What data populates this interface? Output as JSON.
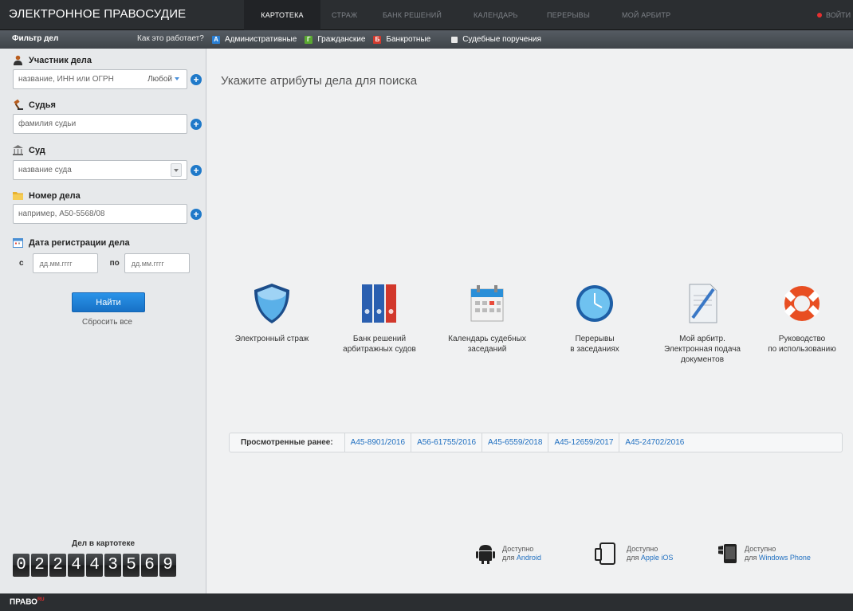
{
  "brand": "ЭЛЕКТРОННОЕ ПРАВОСУДИЕ",
  "nav": [
    "КАРТОТЕКА",
    "СТРАЖ",
    "БАНК РЕШЕНИЙ",
    "КАЛЕНДАРЬ",
    "ПЕРЕРЫВЫ",
    "МОЙ АРБИТР"
  ],
  "login": "ВОЙТИ",
  "filter": {
    "title": "Фильтр дел",
    "how": "Как это работает?",
    "categories": [
      {
        "badge": "А",
        "label": "Административные",
        "color": "#2a7fd4"
      },
      {
        "badge": "Г",
        "label": "Гражданские",
        "color": "#5aa832"
      },
      {
        "badge": "Б",
        "label": "Банкротные",
        "color": "#d23a2e"
      },
      {
        "badge": "",
        "label": "Судебные поручения",
        "color": "#e8e8e8"
      }
    ]
  },
  "sidebar": {
    "participant": {
      "label": "Участник дела",
      "placeholder": "название, ИНН или ОГРН",
      "any": "Любой"
    },
    "judge": {
      "label": "Судья",
      "placeholder": "фамилия судьи"
    },
    "court": {
      "label": "Суд",
      "placeholder": "название суда"
    },
    "case": {
      "label": "Номер дела",
      "placeholder": "например, А50-5568/08"
    },
    "date": {
      "label": "Дата регистрации дела",
      "from": "с",
      "to": "по",
      "placeholder": "дд.мм.гггг"
    },
    "find": "Найти",
    "reset": "Сбросить все",
    "counter_label": "Дел в картотеке",
    "counter": [
      "0",
      "2",
      "2",
      "4",
      "4",
      "3",
      "5",
      "6",
      "9"
    ]
  },
  "main": {
    "hint": "Укажите атрибуты дела для поиска",
    "tiles": [
      {
        "l1": "Электронный страж",
        "l2": "",
        "l3": ""
      },
      {
        "l1": "Банк решений",
        "l2": "арбитражных судов",
        "l3": ""
      },
      {
        "l1": "Календарь судебных",
        "l2": "заседаний",
        "l3": ""
      },
      {
        "l1": "Перерывы",
        "l2": "в заседаниях",
        "l3": ""
      },
      {
        "l1": "Мой арбитр.",
        "l2": "Электронная подача",
        "l3": "документов"
      },
      {
        "l1": "Руководство",
        "l2": "по использованию",
        "l3": ""
      }
    ],
    "recent_label": "Просмотренные ранее:",
    "recent": [
      "А45-8901/2016",
      "А56-61755/2016",
      "А45-6559/2018",
      "А45-12659/2017",
      "А45-24702/2016"
    ],
    "apps": [
      {
        "available": "Доступно",
        "for": "для",
        "platform": "Android"
      },
      {
        "available": "Доступно",
        "for": "для",
        "platform": "Apple iOS"
      },
      {
        "available": "Доступно",
        "for": "для",
        "platform": "Windows Phone"
      }
    ]
  },
  "footer": {
    "logo": "ПРАВО",
    "logo_sup": "RU"
  }
}
